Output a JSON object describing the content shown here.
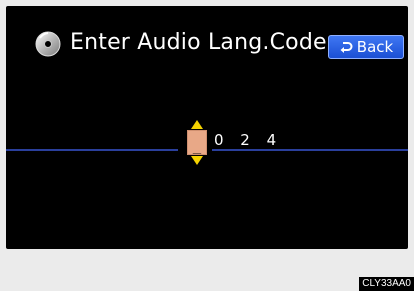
{
  "header": {
    "title": "Enter Audio Lang.Code",
    "back_label": "Back",
    "disc_icon": "disc-icon",
    "back_icon": "return-arrow-icon"
  },
  "entry": {
    "active_digit": "_",
    "remaining_digits": "0 2 4",
    "up_icon": "arrow-up-icon",
    "down_icon": "arrow-down-icon"
  },
  "footer": {
    "image_code": "CLY33AA0"
  },
  "colors": {
    "screen_bg": "#000000",
    "accent_line": "#2a3f9c",
    "arrow": "#f5d300",
    "digit_box": "#e8a887",
    "back_button": "#2b62e6"
  }
}
